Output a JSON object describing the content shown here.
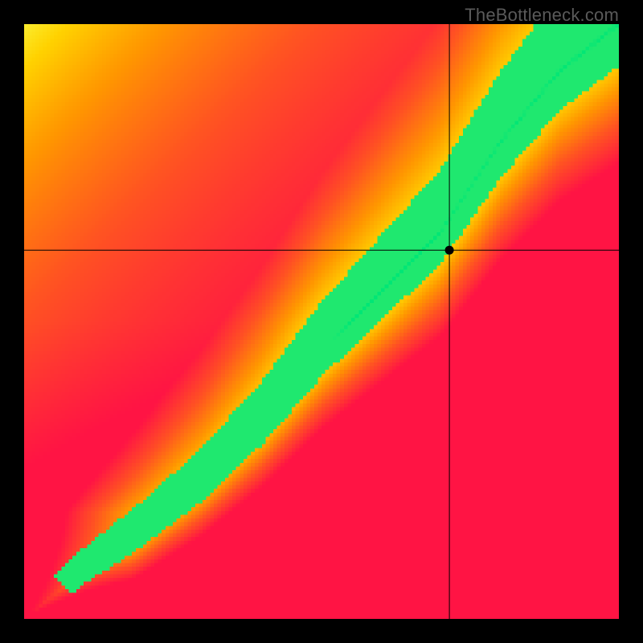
{
  "watermark": {
    "text": "TheBottleneck.com"
  },
  "chart_data": {
    "type": "heatmap",
    "title": "",
    "xlabel": "",
    "ylabel": "",
    "xlim": [
      0,
      1
    ],
    "ylim": [
      0,
      1
    ],
    "crosshair": {
      "x": 0.715,
      "y": 0.62
    },
    "marker": {
      "x": 0.715,
      "y": 0.62
    },
    "optimum_curve": {
      "description": "y as function of x where compatibility is optimal (green band center)",
      "points": [
        {
          "x": 0.0,
          "y": 0.0
        },
        {
          "x": 0.1,
          "y": 0.08
        },
        {
          "x": 0.2,
          "y": 0.15
        },
        {
          "x": 0.3,
          "y": 0.23
        },
        {
          "x": 0.4,
          "y": 0.33
        },
        {
          "x": 0.5,
          "y": 0.45
        },
        {
          "x": 0.55,
          "y": 0.5
        },
        {
          "x": 0.6,
          "y": 0.55
        },
        {
          "x": 0.65,
          "y": 0.6
        },
        {
          "x": 0.7,
          "y": 0.65
        },
        {
          "x": 0.8,
          "y": 0.8
        },
        {
          "x": 0.9,
          "y": 0.92
        },
        {
          "x": 1.0,
          "y": 1.0
        }
      ]
    },
    "color_scale": [
      {
        "value": 0.0,
        "color": "#ff1744",
        "meaning": "severe bottleneck"
      },
      {
        "value": 0.3,
        "color": "#ff5722",
        "meaning": "bottleneck"
      },
      {
        "value": 0.6,
        "color": "#ffc107",
        "meaning": "mild"
      },
      {
        "value": 0.85,
        "color": "#ffeb3b",
        "meaning": "near-optimal"
      },
      {
        "value": 1.0,
        "color": "#00e676",
        "meaning": "optimal"
      }
    ],
    "grid": false,
    "legend": false
  }
}
